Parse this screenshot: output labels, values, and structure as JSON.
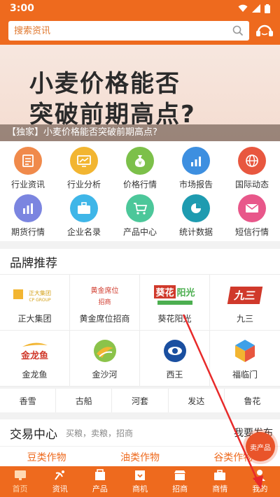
{
  "status": {
    "time": "3:00"
  },
  "search": {
    "placeholder": "搜索资讯"
  },
  "banner": {
    "line1": "小麦价格能否",
    "line2": "突破前期高点?",
    "caption": "【独家】小麦价格能否突破前期高点?"
  },
  "categories": [
    {
      "label": "行业资讯",
      "icon": "news-icon",
      "color": "#f08a4b"
    },
    {
      "label": "行业分析",
      "icon": "analysis-icon",
      "color": "#f2b531"
    },
    {
      "label": "价格行情",
      "icon": "price-icon",
      "color": "#7cc04a"
    },
    {
      "label": "市场报告",
      "icon": "report-icon",
      "color": "#3d8fe0"
    },
    {
      "label": "国际动态",
      "icon": "globe-icon",
      "color": "#e8573f"
    },
    {
      "label": "期货行情",
      "icon": "futures-icon",
      "color": "#7b85e0"
    },
    {
      "label": "企业名录",
      "icon": "briefcase-icon",
      "color": "#3fb6e8"
    },
    {
      "label": "产品中心",
      "icon": "cart-icon",
      "color": "#4cc79a"
    },
    {
      "label": "统计数据",
      "icon": "pie-chart-icon",
      "color": "#1e9bb0"
    },
    {
      "label": "短信行情",
      "icon": "envelope-icon",
      "color": "#e8578a"
    }
  ],
  "brands": {
    "title": "品牌推荐",
    "items": [
      {
        "name": "正大集团",
        "logo_text": "正大集团",
        "logo_sub": "CP GROUP"
      },
      {
        "name": "黄金席位招商",
        "logo_text": "黄金席位",
        "logo_sub": "招商"
      },
      {
        "name": "葵花阳光",
        "logo_text": "葵花",
        "logo_sub": "阳光"
      },
      {
        "name": "九三",
        "logo_text": "九三",
        "logo_sub": ""
      },
      {
        "name": "金龙鱼",
        "logo_text": "金龙鱼",
        "logo_sub": ""
      },
      {
        "name": "金沙河",
        "logo_text": "",
        "logo_sub": ""
      },
      {
        "name": "西王",
        "logo_text": "",
        "logo_sub": ""
      },
      {
        "name": "福临门",
        "logo_text": "",
        "logo_sub": ""
      }
    ],
    "tags": [
      "香雪",
      "古船",
      "河套",
      "发达",
      "鲁花"
    ]
  },
  "trade": {
    "title": "交易中心",
    "subtitle": "买粮，卖粮，招商",
    "action": "我要发布",
    "tabs": [
      "豆类作物",
      "油类作物",
      "谷类作物"
    ]
  },
  "float_button": {
    "label": "卖产品"
  },
  "nav": [
    {
      "label": "首页",
      "icon": "home-icon"
    },
    {
      "label": "资讯",
      "icon": "satellite-icon"
    },
    {
      "label": "产品",
      "icon": "product-icon"
    },
    {
      "label": "商机",
      "icon": "opportunity-icon"
    },
    {
      "label": "招商",
      "icon": "store-icon"
    },
    {
      "label": "商情",
      "icon": "business-icon"
    },
    {
      "label": "我的",
      "icon": "user-icon"
    }
  ],
  "colors": {
    "brand": "#ee6a1e",
    "accent": "#e9542a"
  }
}
